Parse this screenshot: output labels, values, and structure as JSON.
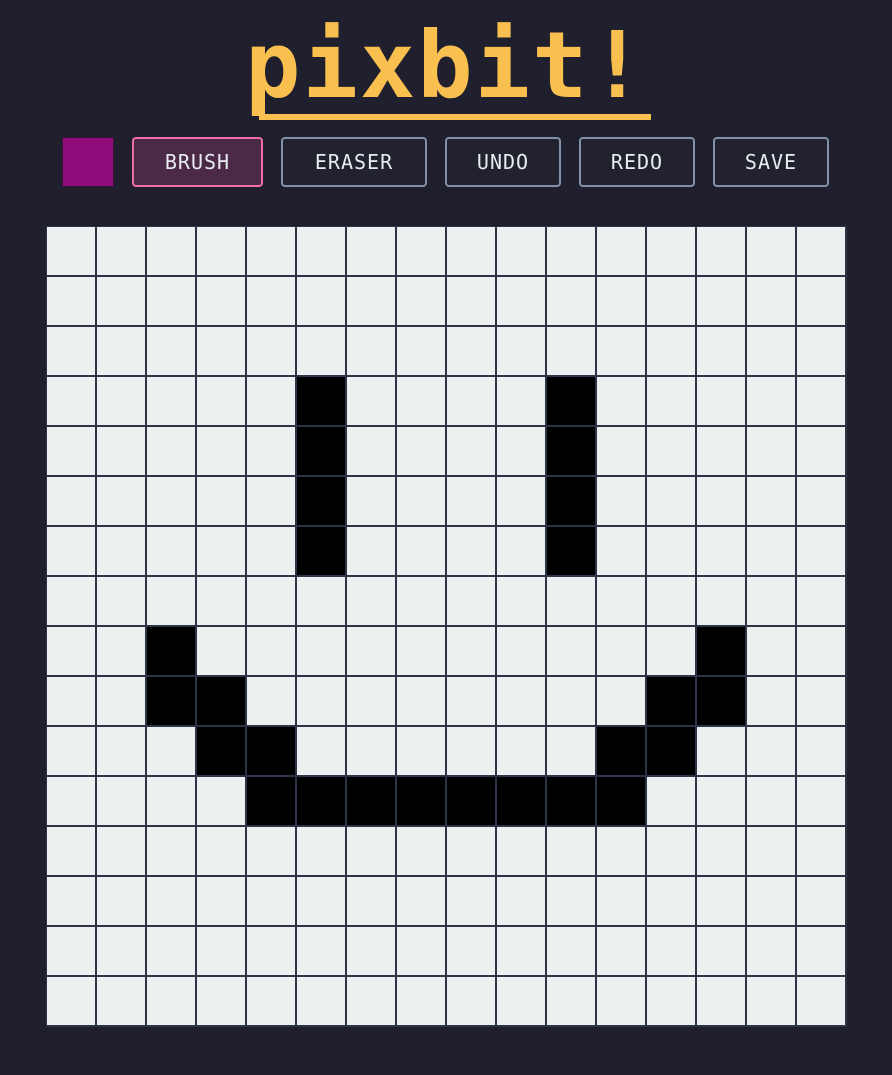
{
  "app": {
    "logo": "pixbit!"
  },
  "toolbar": {
    "current_color": "#8e0c7c",
    "buttons": [
      {
        "label": "BRUSH",
        "active": true
      },
      {
        "label": "ERASER",
        "active": false
      },
      {
        "label": "UNDO",
        "active": false
      },
      {
        "label": "REDO",
        "active": false
      },
      {
        "label": "SAVE",
        "active": false
      }
    ]
  },
  "canvas": {
    "columns": 16,
    "rows": 16,
    "empty_color": "#ecf0f1",
    "filled_color": "#000000",
    "pixels": [
      "0000000000000000",
      "0000000000000000",
      "0000000000000000",
      "0000010000100000",
      "0000010000100000",
      "0000010000100000",
      "0000010000100000",
      "0000000000000000",
      "0010000000000100",
      "0011000000001100",
      "0001100000011000",
      "0000111111110000",
      "0000000000000000",
      "0000000000000000",
      "0000000000000000",
      "0000000000000000"
    ]
  }
}
